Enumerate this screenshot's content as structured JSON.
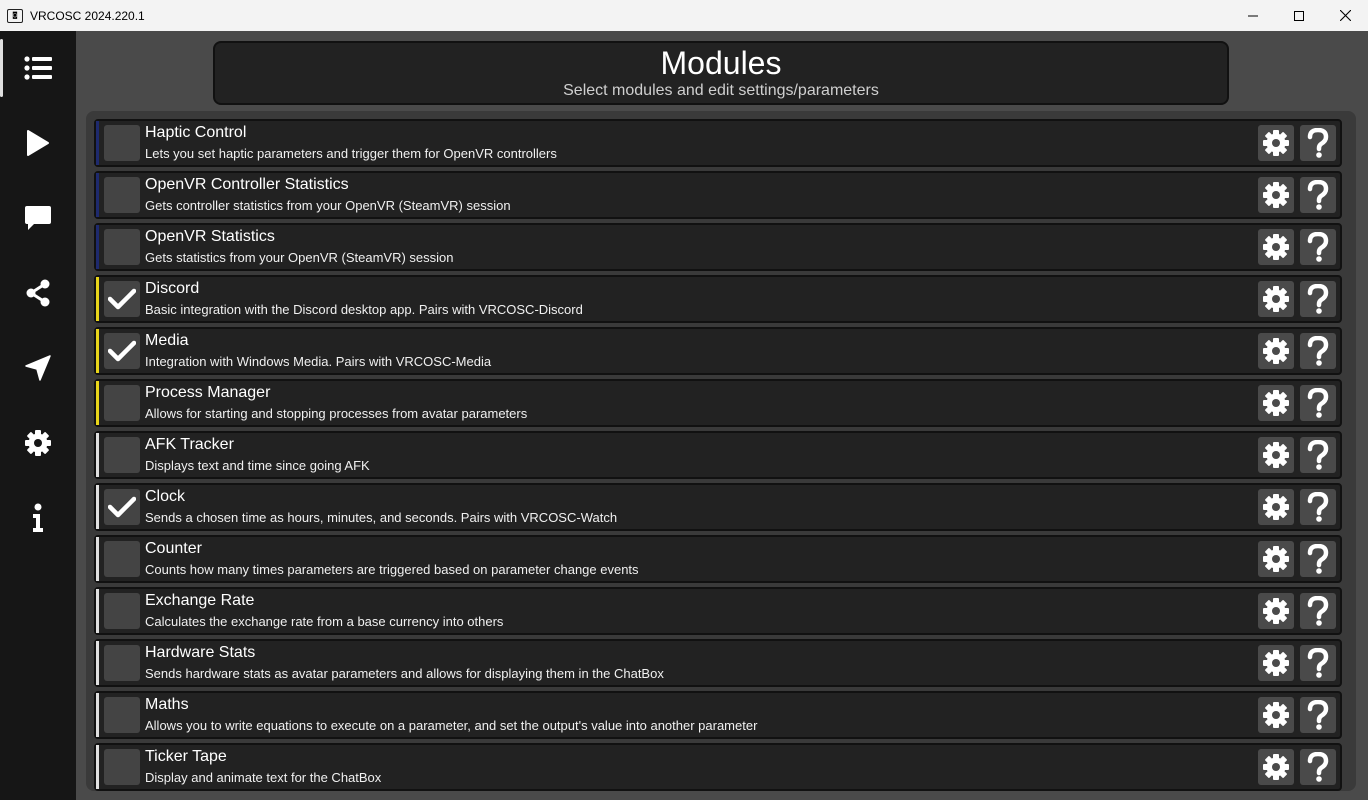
{
  "window": {
    "title": "VRCOSC 2024.220.1",
    "icon_name": "vrcosc-logo-icon",
    "minimize_icon": "minimize-icon",
    "maximize_icon": "maximize-icon",
    "close_icon": "close-icon"
  },
  "sidebar": {
    "items": [
      {
        "name": "modules",
        "icon": "list-icon",
        "active": true
      },
      {
        "name": "run",
        "icon": "play-icon",
        "active": false
      },
      {
        "name": "chatbox",
        "icon": "chat-bubble-icon",
        "active": false
      },
      {
        "name": "router",
        "icon": "share-icon",
        "active": false
      },
      {
        "name": "startup",
        "icon": "location-arrow-icon",
        "active": false
      },
      {
        "name": "settings",
        "icon": "gear-icon",
        "active": false
      },
      {
        "name": "about",
        "icon": "info-icon",
        "active": false
      }
    ]
  },
  "header": {
    "title": "Modules",
    "subtitle": "Select modules and edit settings/parameters"
  },
  "colors": {
    "accent_blue": "#1e2a6e",
    "accent_yellow": "#e8d51a",
    "accent_white": "#e0e0e0"
  },
  "modules": [
    {
      "name": "Haptic Control",
      "description": "Lets you set haptic parameters and trigger them for OpenVR controllers",
      "enabled": false,
      "accent": "#1e2a6e"
    },
    {
      "name": "OpenVR Controller Statistics",
      "description": "Gets controller statistics from your OpenVR (SteamVR) session",
      "enabled": false,
      "accent": "#1e2a6e"
    },
    {
      "name": "OpenVR Statistics",
      "description": "Gets statistics from your OpenVR (SteamVR) session",
      "enabled": false,
      "accent": "#1e2a6e"
    },
    {
      "name": "Discord",
      "description": "Basic integration with the Discord desktop app. Pairs with VRCOSC-Discord",
      "enabled": true,
      "accent": "#e8d51a"
    },
    {
      "name": "Media",
      "description": "Integration with Windows Media. Pairs with VRCOSC-Media",
      "enabled": true,
      "accent": "#e8d51a"
    },
    {
      "name": "Process Manager",
      "description": "Allows for starting and stopping processes from avatar parameters",
      "enabled": false,
      "accent": "#e8d51a"
    },
    {
      "name": "AFK Tracker",
      "description": "Displays text and time since going AFK",
      "enabled": false,
      "accent": "#e0e0e0"
    },
    {
      "name": "Clock",
      "description": "Sends a chosen time as hours, minutes, and seconds. Pairs with VRCOSC-Watch",
      "enabled": true,
      "accent": "#e0e0e0"
    },
    {
      "name": "Counter",
      "description": "Counts how many times parameters are triggered based on parameter change events",
      "enabled": false,
      "accent": "#e0e0e0"
    },
    {
      "name": "Exchange Rate",
      "description": "Calculates the exchange rate from a base currency into others",
      "enabled": false,
      "accent": "#e0e0e0"
    },
    {
      "name": "Hardware Stats",
      "description": "Sends hardware stats as avatar parameters and allows for displaying them in the ChatBox",
      "enabled": false,
      "accent": "#e0e0e0"
    },
    {
      "name": "Maths",
      "description": "Allows you to write equations to execute on a parameter, and set the output's value into another parameter",
      "enabled": false,
      "accent": "#e0e0e0"
    },
    {
      "name": "Ticker Tape",
      "description": "Display and animate text for the ChatBox",
      "enabled": false,
      "accent": "#e0e0e0"
    }
  ]
}
